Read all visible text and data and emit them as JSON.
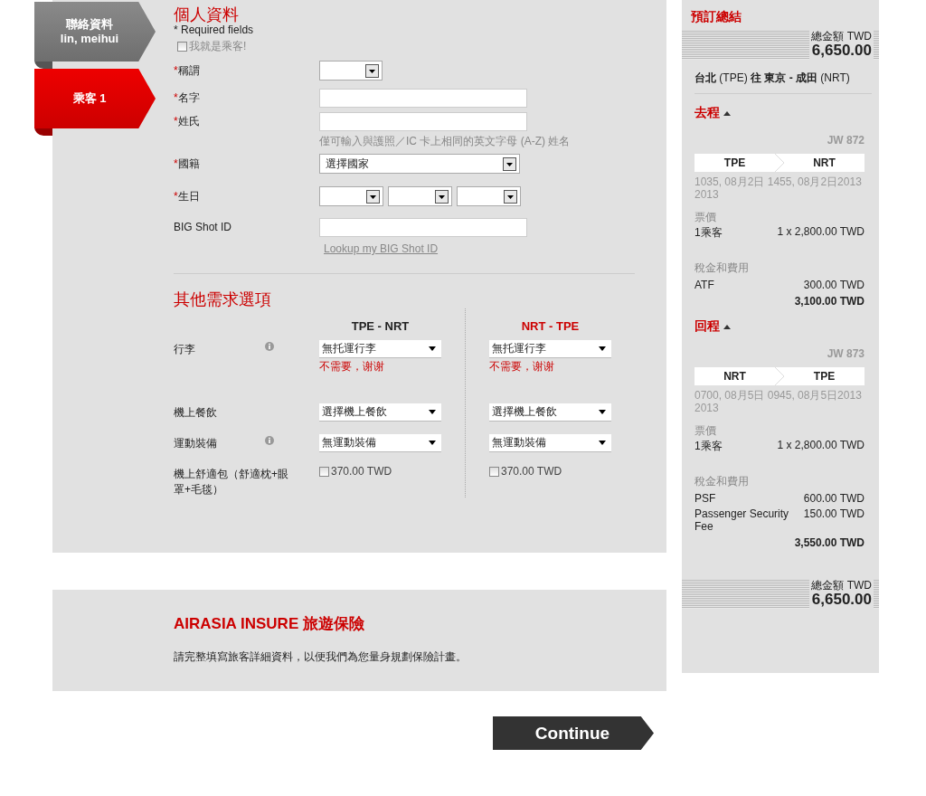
{
  "passenger_tabs": [
    {
      "title": "聯絡資料",
      "subtitle": "lin, meihui",
      "selected": false
    },
    {
      "title": "乘客 1",
      "selected": true
    }
  ],
  "personal": {
    "title": "個人資料",
    "required_note": "* Required fields",
    "self_checkbox": {
      "label": "我就是乘客!",
      "checked": false
    },
    "fields": [
      {
        "kind": "select",
        "label": "稱謂",
        "required_mark": "*"
      },
      {
        "kind": "text",
        "label": "名字",
        "required_mark": "*"
      },
      {
        "kind": "text",
        "label": "姓氏",
        "required_mark": "*",
        "hint": "僅可輸入與護照／IC 卡上相同的英文字母 (A-Z) 姓名"
      },
      {
        "kind": "wide-select",
        "label": "國籍",
        "required_mark": "*",
        "value": "選擇國家"
      },
      {
        "kind": "date",
        "label": "生日",
        "required_mark": "*"
      },
      {
        "kind": "text",
        "label": "BIG Shot ID",
        "link": "Lookup my BIG Shot ID"
      }
    ]
  },
  "other": {
    "title": "其他需求選項",
    "routes": [
      {
        "label": "TPE - NRT",
        "selected": false
      },
      {
        "label": "NRT - TPE",
        "selected": true
      }
    ],
    "rows": [
      {
        "kind": "select",
        "label": "行李",
        "info": true,
        "cells": [
          {
            "value": "無托運行李",
            "note": "不需要，谢谢"
          },
          {
            "value": "無托運行李",
            "note": "不需要，谢谢"
          }
        ]
      },
      {
        "kind": "select",
        "label": "機上餐飲",
        "info": false,
        "cells": [
          {
            "value": "選擇機上餐飲"
          },
          {
            "value": "選擇機上餐飲"
          }
        ]
      },
      {
        "kind": "select",
        "label": "運動裝備",
        "info": true,
        "cells": [
          {
            "value": "無運動裝備"
          },
          {
            "value": "無運動裝備"
          }
        ]
      },
      {
        "kind": "checkbox",
        "label": "機上舒適包（舒適枕+眼罩+毛毯）",
        "info": false,
        "cells": [
          {
            "value": "370.00 TWD",
            "checked": false
          },
          {
            "value": "370.00 TWD",
            "checked": false
          }
        ]
      }
    ]
  },
  "insurance": {
    "title": "AIRASIA INSURE 旅遊保險",
    "text": "請完整填寫旅客詳細資料，以便我們為您量身規劃保險計畫。"
  },
  "continue_button": "Continue",
  "summary": {
    "title": "預訂總結",
    "total_top": {
      "label": "總金額",
      "currency": "TWD",
      "amount": "6,650.00"
    },
    "route": "**台北** (TPE) **往 東京 - 成田** (NRT)",
    "legs": [
      {
        "title": "去程",
        "expanded": true,
        "flight": "JW 872",
        "from": "TPE",
        "to": "NRT",
        "times": "1035, 08月2日 1455, 08月2日2013 2013",
        "fare_label": "票價",
        "fares": [
          {
            "label": "1乘客",
            "amount": "1 x 2,800.00 TWD"
          }
        ],
        "tax_label": "稅金和費用",
        "taxes": [
          {
            "label": "ATF",
            "amount": "300.00 TWD"
          }
        ],
        "subtotal": "3,100.00 TWD"
      },
      {
        "title": "回程",
        "expanded": true,
        "flight": "JW 873",
        "from": "NRT",
        "to": "TPE",
        "times": "0700, 08月5日 0945, 08月5日2013 2013",
        "fare_label": "票價",
        "fares": [
          {
            "label": "1乘客",
            "amount": "1 x 2,800.00 TWD"
          }
        ],
        "tax_label": "稅金和費用",
        "taxes": [
          {
            "label": "PSF",
            "amount": "600.00 TWD"
          },
          {
            "label": "Passenger Security Fee",
            "amount": "150.00 TWD"
          }
        ],
        "subtotal": "3,550.00 TWD"
      }
    ],
    "total_bottom": {
      "label": "總金額",
      "currency": "TWD",
      "amount": "6,650.00"
    }
  }
}
